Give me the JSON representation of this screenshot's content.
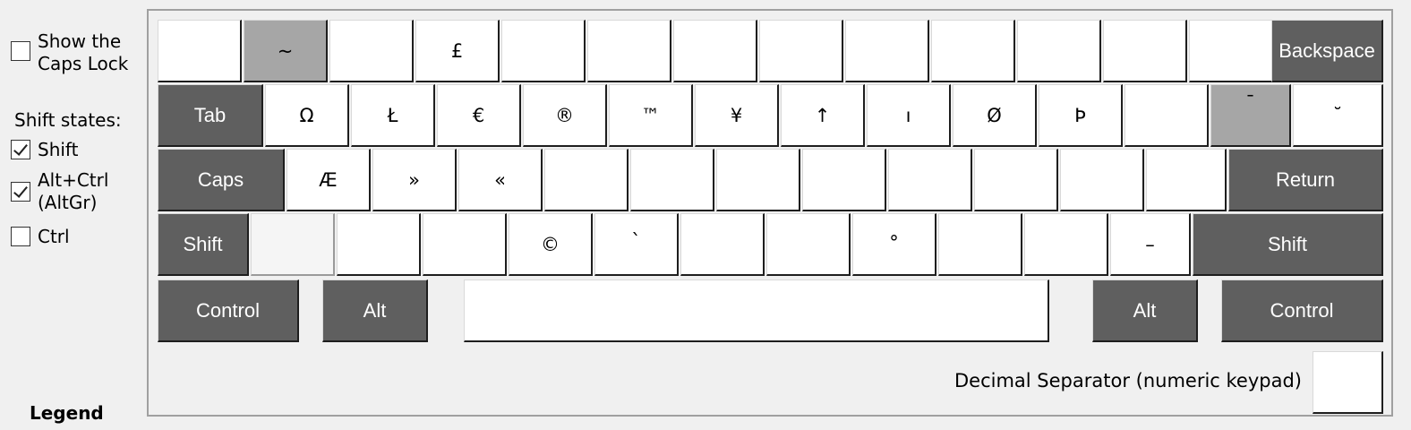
{
  "sidebar": {
    "caps_lock": {
      "label_line1": "Show the",
      "label_line2": "Caps Lock",
      "checked": false
    },
    "shift_states_title": "Shift states:",
    "shift": {
      "label": "Shift",
      "checked": true
    },
    "altgr": {
      "label_line1": "Alt+Ctrl",
      "label_line2": "(AltGr)",
      "checked": true
    },
    "ctrl": {
      "label": "Ctrl",
      "checked": false
    },
    "legend": "Legend"
  },
  "rows": {
    "r1": [
      "",
      "~",
      "",
      "£",
      "",
      "",
      "",
      "",
      "",
      "",
      "",
      "",
      ""
    ],
    "r1_backspace": "Backspace",
    "r2_tab": "Tab",
    "r2": [
      "Ω",
      "Ł",
      "€",
      "®",
      "™",
      "¥",
      "↑",
      "ı",
      "Ø",
      "Þ",
      "",
      "¯",
      "˘"
    ],
    "r3_caps": "Caps",
    "r3": [
      "Æ",
      "»",
      "«",
      "",
      "",
      "",
      "",
      "",
      "",
      "",
      ""
    ],
    "r3_return": "Return",
    "r4_lshift": "Shift",
    "r4": [
      "",
      "",
      "",
      "©",
      "`",
      "",
      "",
      "°",
      "",
      "",
      "–"
    ],
    "r4_rshift": "Shift",
    "r5": {
      "lcontrol": "Control",
      "lalt": "Alt",
      "space": "",
      "ralt": "Alt",
      "rcontrol": "Control"
    }
  },
  "decimal_separator": {
    "label": "Decimal Separator (numeric keypad)",
    "value": ""
  },
  "colors": {
    "modifier": "#5f5f5f",
    "dead_key": "#a6a6a6",
    "key": "#ffffff",
    "background": "#f0f0f0"
  }
}
